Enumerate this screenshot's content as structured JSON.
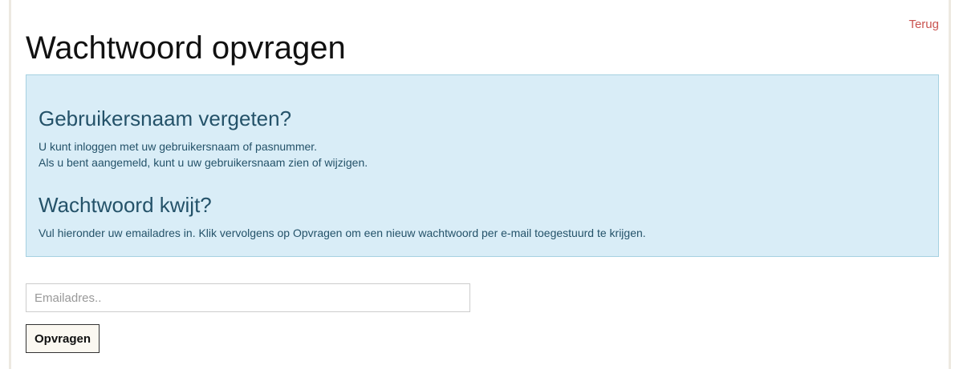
{
  "header": {
    "back_link": "Terug",
    "title": "Wachtwoord opvragen"
  },
  "info": {
    "username_heading": "Gebruikersnaam vergeten?",
    "username_text_1": "U kunt inloggen met uw gebruikersnaam of pasnummer.",
    "username_text_2": "Als u bent aangemeld, kunt u uw gebruikersnaam zien of wijzigen.",
    "password_heading": "Wachtwoord kwijt?",
    "password_text": "Vul hieronder uw emailadres in. Klik vervolgens op Opvragen om een nieuw wachtwoord per e-mail toegestuurd te krijgen."
  },
  "form": {
    "email_value": "",
    "email_placeholder": "Emailadres..",
    "submit_label": "Opvragen"
  },
  "colors": {
    "link": "#c9534f",
    "info_background": "#d9edf7",
    "info_border": "#a6d1e1",
    "info_text": "#245269",
    "button_background": "#fbf8f1"
  }
}
